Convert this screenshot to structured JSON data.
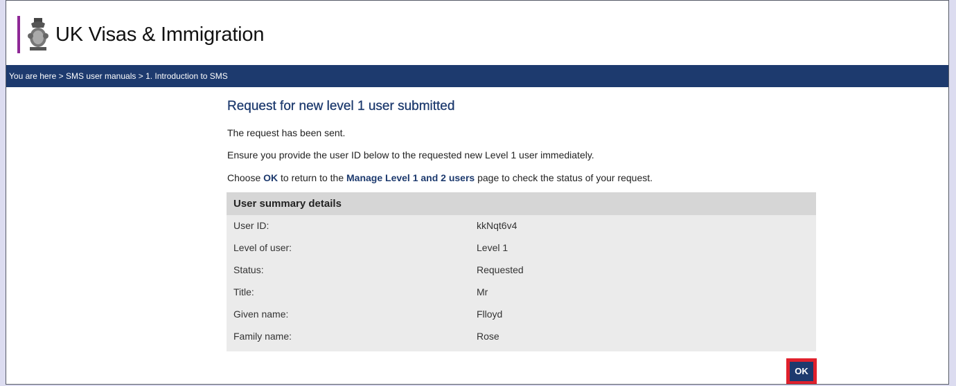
{
  "header": {
    "brand": "UK Visas & Immigration"
  },
  "breadcrumb": {
    "prefix": "You are here",
    "sep": ">",
    "items": [
      "SMS user manuals",
      "1. Introduction to SMS"
    ]
  },
  "main": {
    "title": "Request for new level 1 user submitted",
    "para1": "The request has been sent.",
    "para2": "Ensure you provide the user ID below to the requested new Level 1 user immediately.",
    "para3": {
      "pre": "Choose",
      "ok": "OK",
      "mid": "to return to the",
      "link": "Manage Level 1 and 2 users",
      "post": "page to check the status of your request."
    }
  },
  "summary": {
    "heading": "User summary details",
    "rows": [
      {
        "label": "User ID:",
        "value": "kkNqt6v4"
      },
      {
        "label": "Level of user:",
        "value": "Level 1"
      },
      {
        "label": "Status:",
        "value": "Requested"
      },
      {
        "label": "Title:",
        "value": "Mr"
      },
      {
        "label": "Given name:",
        "value": "Flloyd"
      },
      {
        "label": "Family name:",
        "value": "Rose"
      }
    ]
  },
  "ok_button": {
    "label": "OK"
  },
  "colors": {
    "navy": "#1d3a6e",
    "purple": "#8e2896",
    "highlight": "#e0202c"
  }
}
